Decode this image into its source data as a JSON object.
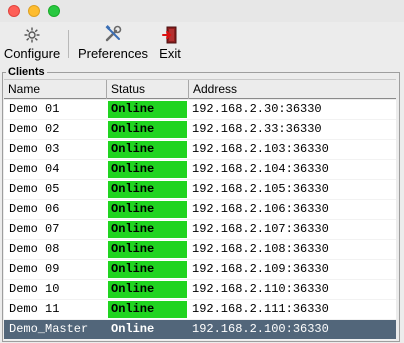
{
  "window": {
    "traffic_lights": {
      "close_color": "#fe5f57",
      "minimize_color": "#febc2e",
      "zoom_color": "#28c840"
    }
  },
  "toolbar": {
    "configure_label": "Configure",
    "preferences_label": "Preferences",
    "exit_label": "Exit"
  },
  "clients": {
    "group_title": "Clients",
    "columns": {
      "name": "Name",
      "status": "Status",
      "address": "Address"
    },
    "status_color": "#20d420",
    "selected_row_color": "#52667a",
    "rows": [
      {
        "name": "Demo 01",
        "status": "Online",
        "address": "192.168.2.30:36330"
      },
      {
        "name": "Demo 02",
        "status": "Online",
        "address": "192.168.2.33:36330"
      },
      {
        "name": "Demo 03",
        "status": "Online",
        "address": "192.168.2.103:36330"
      },
      {
        "name": "Demo 04",
        "status": "Online",
        "address": "192.168.2.104:36330"
      },
      {
        "name": "Demo 05",
        "status": "Online",
        "address": "192.168.2.105:36330"
      },
      {
        "name": "Demo 06",
        "status": "Online",
        "address": "192.168.2.106:36330"
      },
      {
        "name": "Demo 07",
        "status": "Online",
        "address": "192.168.2.107:36330"
      },
      {
        "name": "Demo 08",
        "status": "Online",
        "address": "192.168.2.108:36330"
      },
      {
        "name": "Demo 09",
        "status": "Online",
        "address": "192.168.2.109:36330"
      },
      {
        "name": "Demo 10",
        "status": "Online",
        "address": "192.168.2.110:36330"
      },
      {
        "name": "Demo 11",
        "status": "Online",
        "address": "192.168.2.111:36330"
      },
      {
        "name": "Demo_Master",
        "status": "Online",
        "address": "192.168.2.100:36330",
        "selected": true
      }
    ]
  }
}
